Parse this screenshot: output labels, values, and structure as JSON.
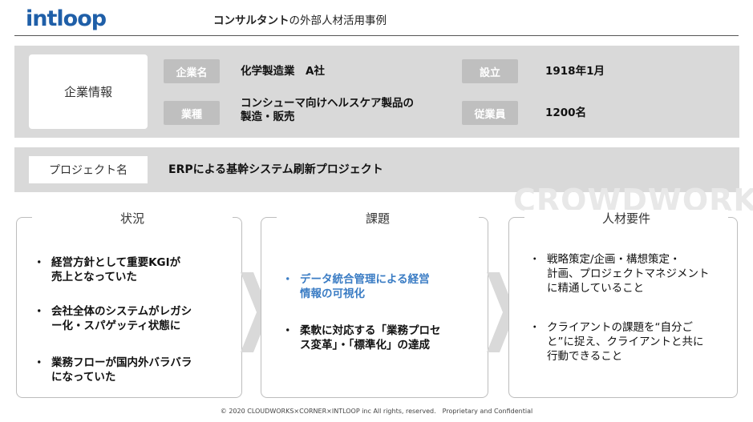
{
  "header": {
    "logo": "intloop",
    "title_bold": "コンサルタント",
    "title_rest": "の外部人材活用事例"
  },
  "company": {
    "section_label": "企業情報",
    "name_label": "企業名",
    "name_value": "化学製造業　A社",
    "founded_label": "設立",
    "founded_value": "1918年1月",
    "industry_label": "業種",
    "industry_value_1": "コンシューマ向けヘルスケア製品の",
    "industry_value_2": "製造・販売",
    "employees_label": "従業員",
    "employees_value": "1200名"
  },
  "project": {
    "label": "プロジェクト名",
    "value": "ERPによる基幹システム刷新プロジェクト"
  },
  "watermark": "CROWDWORKS",
  "columns": [
    {
      "title": "状況",
      "bullets": [
        {
          "line1": "経営方針として重要KGIが",
          "line2": "売上となっていた"
        },
        {
          "line1": "会社全体のシステムがレガシ",
          "line2": "ー化・スパゲッティ状態に"
        },
        {
          "line1": "業務フローが国内外バラバラ",
          "line2": "になっていた"
        }
      ]
    },
    {
      "title": "課題",
      "bullets": [
        {
          "line1": "データ統合管理による経営",
          "line2": "情報の可視化"
        },
        {
          "line1": "柔軟に対応する「業務プロセ",
          "line2": "ス変革」・「標準化」の達成"
        }
      ]
    },
    {
      "title": "人材要件",
      "bullets": [
        {
          "line1": "戦略策定/企画・構想策定・",
          "line2": "計画、プロジェクトマネジメント",
          "line3": "に精通していること"
        },
        {
          "line1": "クライアントの課題を“自分ご",
          "line2": "と”に捉え、クライアントと共に",
          "line3": "行動できること"
        }
      ]
    }
  ],
  "bullet_char": "・",
  "footer": "© 2020 CLOUDWORKS×CORNER×INTLOOP inc All rights, reserved.　Proprietary and Confidential",
  "colors": {
    "brand": "#1f5fa8",
    "accent_blue": "#3a7cc4",
    "label_gray": "#bfbfbf",
    "band_gray": "#d9d9d9"
  }
}
